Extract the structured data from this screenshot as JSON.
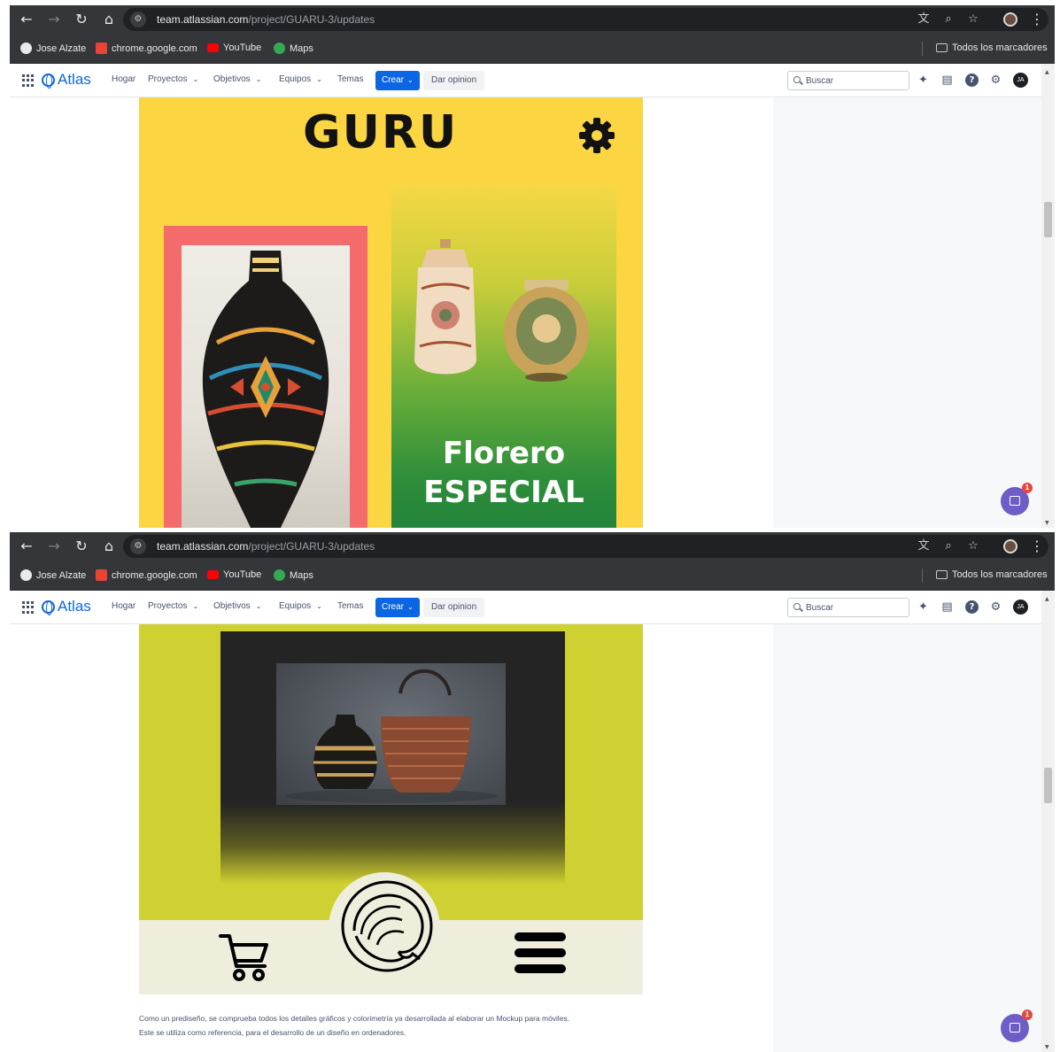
{
  "browser": {
    "url_host": "team.atlassian.com",
    "url_path": "/project/GUARU-3/updates",
    "bookmarks": [
      {
        "label": "Jose Alzate",
        "icon": "globe-icon",
        "color": "#e8eaed"
      },
      {
        "label": "chrome.google.com",
        "icon": "chrome-web-store-icon",
        "color": "#ea4335"
      },
      {
        "label": "YouTube",
        "icon": "youtube-icon",
        "color": "#ff0000"
      },
      {
        "label": "Maps",
        "icon": "maps-icon",
        "color": "#34a853"
      }
    ],
    "all_bookmarks": "Todos los marcadores"
  },
  "atlas": {
    "logo": "Atlas",
    "nav": [
      "Hogar",
      "Proyectos",
      "Objetivos",
      "Equipos",
      "Temas"
    ],
    "create": "Crear",
    "feedback": "Dar opinion",
    "search_placeholder": "Buscar",
    "avatar": "JA",
    "accent": "#0c66e4"
  },
  "mockup1": {
    "title": "GURU",
    "headline1": "Florero",
    "headline2": "ESPECIAL"
  },
  "notification_count": "1",
  "description": [
    "Como un prediseño, se comprueba todos los detalles gráficos y colorimetría ya desarrollada al elaborar un Mockup para móviles.",
    "Este se utiliza como referencia, para el desarrollo de un diseño en ordenadores."
  ]
}
